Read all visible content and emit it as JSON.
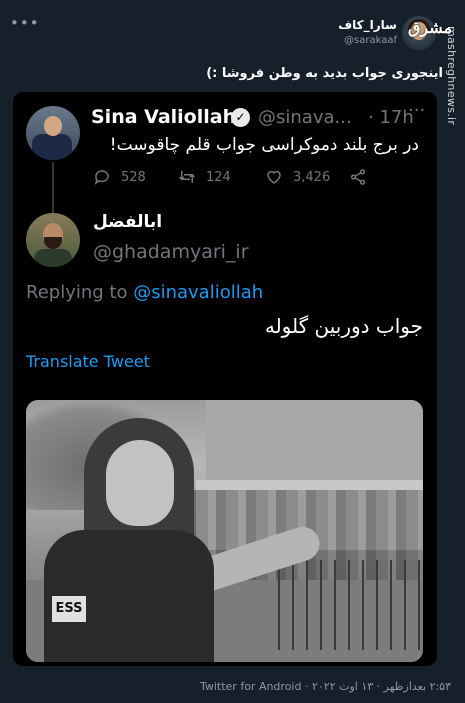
{
  "tweet": {
    "author_name": "سارا_کاف",
    "author_handle": "@sarakaaf",
    "text": "اینجوری جواب بدید به وطن فروشا :)",
    "footer": "۲:۵۳ بعدازظهر · ۱۳ اوت ۲۰۲۲ · Twitter for Android"
  },
  "watermark": {
    "logo_text": "مشرق",
    "site": "mashreghnews.ir"
  },
  "embedded": {
    "original": {
      "name": "Sina Valiollah",
      "handle": "@sinava...",
      "time": "· 17h",
      "text": "در برج بلند دموکراسی جواب قلم چاقوست!",
      "replies": "528",
      "retweets": "124",
      "likes": "3,426"
    },
    "quote": {
      "name": "ابالفضل",
      "handle": "@ghadamyari_ir",
      "replying_prefix": "Replying to ",
      "replying_mention": "@sinavaliollah",
      "text": "جواب دوربین گلوله",
      "translate_label": "Translate Tweet"
    },
    "photo": {
      "vest_label": "ESS"
    }
  },
  "colors": {
    "background": "#15202b",
    "embed_background": "#000000",
    "link_blue": "#1d9bf0",
    "muted": "#71767b"
  }
}
